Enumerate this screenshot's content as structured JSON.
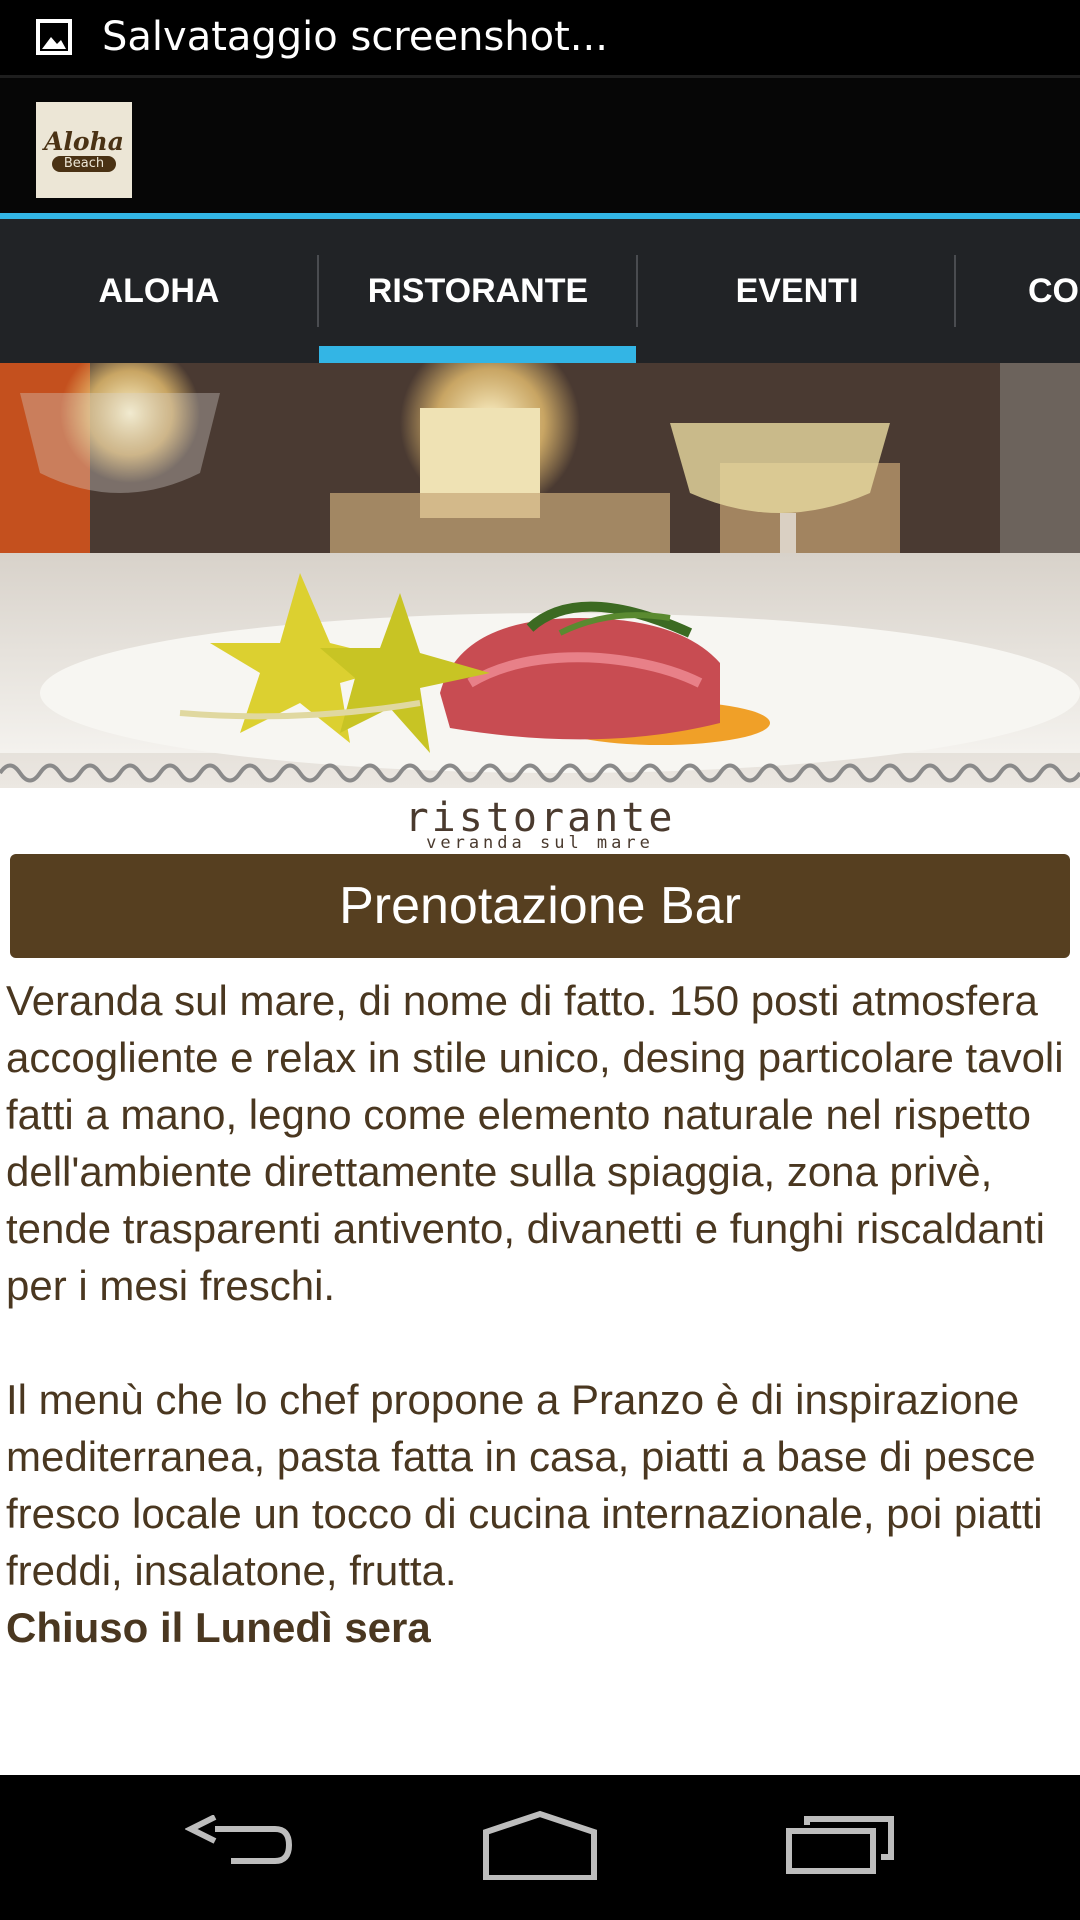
{
  "status_bar": {
    "notification_icon": "image-icon",
    "text": "Salvataggio screenshot..."
  },
  "action_bar": {
    "logo": {
      "word": "Aloha",
      "badge": "Beach"
    }
  },
  "tabs": {
    "items": [
      {
        "label": "ALOHA",
        "selected": false
      },
      {
        "label": "RISTORANTE",
        "selected": true
      },
      {
        "label": "EVENTI",
        "selected": false
      },
      {
        "label": "CO",
        "selected": false
      }
    ]
  },
  "restaurant_logo": {
    "title": "ristorante",
    "subtitle": "veranda sul mare"
  },
  "booking_button": {
    "label": "Prenotazione Bar"
  },
  "description": {
    "paragraph1": "Veranda sul mare, di nome di fatto. 150 posti atmosfera accogliente e relax in stile unico, desing particolare tavoli fatti a mano, legno come elemento naturale nel rispetto dell'ambiente direttamente sulla spiaggia, zona privè, tende trasparenti antivento, divanetti e funghi riscaldanti per i mesi freschi.",
    "paragraph2": "Il menù che lo chef propone a Pranzo è di inspirazione mediterranea, pasta fatta in casa, piatti a base di pesce fresco locale un tocco di cucina internazionale, poi piatti freddi, insalatone, frutta.",
    "closed_note": "Chiuso il Lunedì sera"
  },
  "nav_bar": {
    "icons": [
      "back-icon",
      "home-icon",
      "recent-apps-icon"
    ]
  },
  "colors": {
    "accent": "#33b5e5",
    "brand_brown": "#563f20",
    "text_brown": "#4a3720",
    "tab_bg": "#212326"
  }
}
